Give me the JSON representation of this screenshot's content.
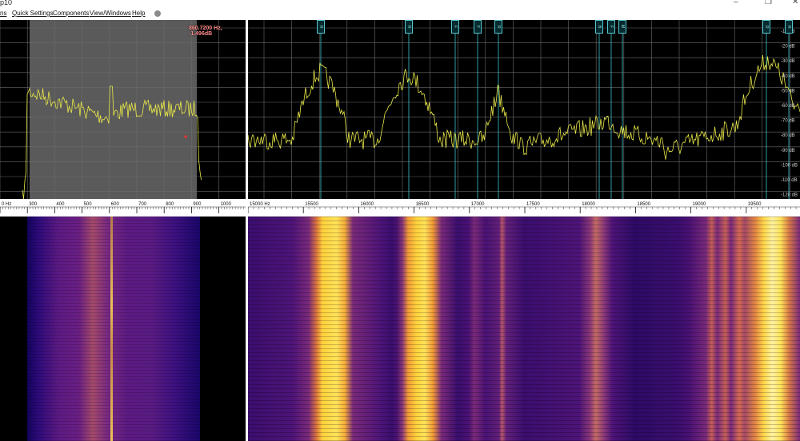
{
  "window": {
    "title": "p10",
    "minimize_glyph": "–",
    "maximize_glyph": "❐",
    "close_glyph": "✕"
  },
  "menu": {
    "items": [
      "ns",
      "Quick Settings",
      "Components",
      "View/Windows",
      "Help"
    ]
  },
  "left_panel": {
    "readout": "860.7200 Hz, -1.496dB",
    "axis_ticks": [
      "0 Hz",
      "300",
      "400",
      "500",
      "600",
      "700",
      "800",
      "900",
      "1000"
    ]
  },
  "right_panel": {
    "db_labels": [
      "-10 dB",
      "-20 dB",
      "-30 dB",
      "-40 dB",
      "-50 dB",
      "-60 dB",
      "-70 dB",
      "-80 dB",
      "-90 dB",
      "-100 dB",
      "-110 dB",
      "-120 dB"
    ],
    "axis_ticks": [
      "15000 Hz",
      "15500",
      "16000",
      "16500",
      "17000",
      "17500",
      "18000",
      "18500",
      "19000",
      "19500"
    ],
    "markers": [
      "R",
      "R",
      "F",
      "F",
      "R",
      "B",
      "F",
      "M",
      "R",
      "R"
    ]
  },
  "colors": {
    "grid": "#6b6b6b",
    "trace": "#e8e84a",
    "marker": "#3fc4cc",
    "selection": "#5a5a5a",
    "waterfall_bg": "#1b0540"
  }
}
